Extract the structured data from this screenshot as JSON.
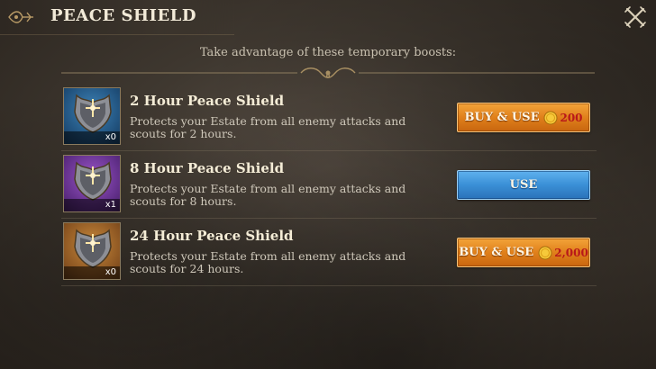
{
  "header": {
    "title": "PEACE SHIELD"
  },
  "subtitle": "Take advantage of these temporary boosts:",
  "items": [
    {
      "name": "2 Hour Peace Shield",
      "description": "Protects your Estate from all enemy attacks and scouts for 2 hours.",
      "quantity": "x0",
      "icon": "shield-icon",
      "rarity_color": "#1f4f7a",
      "button": {
        "label": "BUY & USE",
        "price": "200",
        "color": "#e0801b"
      }
    },
    {
      "name": "8 Hour Peace Shield",
      "description": "Protects your Estate from all enemy attacks and scouts for 8 hours.",
      "quantity": "x1",
      "icon": "shield-icon",
      "rarity_color": "#5e2d85",
      "button": {
        "label": "USE",
        "color": "#3a8fd6"
      }
    },
    {
      "name": "24 Hour Peace Shield",
      "description": "Protects your Estate from all enemy attacks and scouts for 24 hours.",
      "quantity": "x0",
      "icon": "shield-icon",
      "rarity_color": "#8a5421",
      "button": {
        "label": "BUY & USE",
        "price": "2,000",
        "color": "#e0801b"
      }
    }
  ]
}
